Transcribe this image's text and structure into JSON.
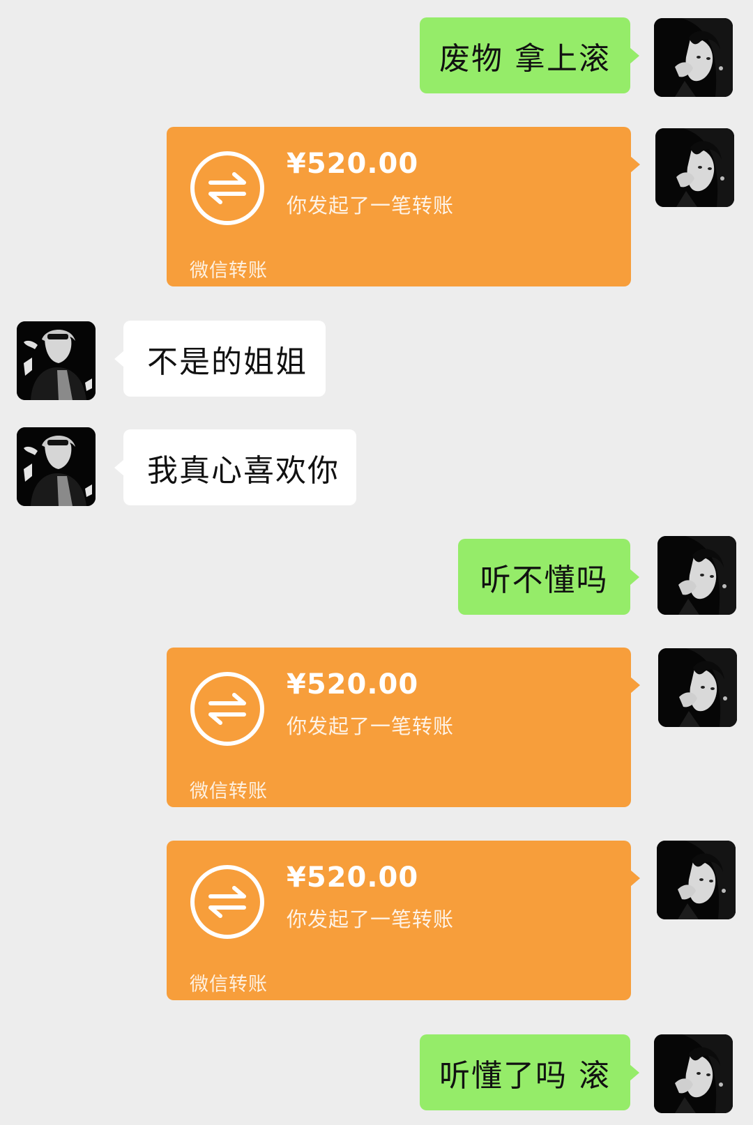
{
  "chat": {
    "messages": [
      {
        "side": "right",
        "type": "text",
        "text": "废物 拿上滚"
      },
      {
        "side": "right",
        "type": "transfer",
        "amount": "¥520.00",
        "desc": "你发起了一笔转账",
        "brand": "微信转账"
      },
      {
        "side": "left",
        "type": "text",
        "text": "不是的姐姐"
      },
      {
        "side": "left",
        "type": "text",
        "text": "我真心喜欢你"
      },
      {
        "side": "right",
        "type": "text",
        "text": "听不懂吗"
      },
      {
        "side": "right",
        "type": "transfer",
        "amount": "¥520.00",
        "desc": "你发起了一笔转账",
        "brand": "微信转账"
      },
      {
        "side": "right",
        "type": "transfer",
        "amount": "¥520.00",
        "desc": "你发起了一笔转账",
        "brand": "微信转账"
      },
      {
        "side": "right",
        "type": "text",
        "text": "听懂了吗 滚"
      }
    ]
  },
  "icons": {
    "transfer": "transfer-arrows-icon",
    "avatar_self": "avatar-girl",
    "avatar_other": "avatar-boy"
  },
  "colors": {
    "background": "#ededed",
    "sent_bubble": "#95ec69",
    "received_bubble": "#ffffff",
    "transfer_card": "#f79e3b"
  }
}
